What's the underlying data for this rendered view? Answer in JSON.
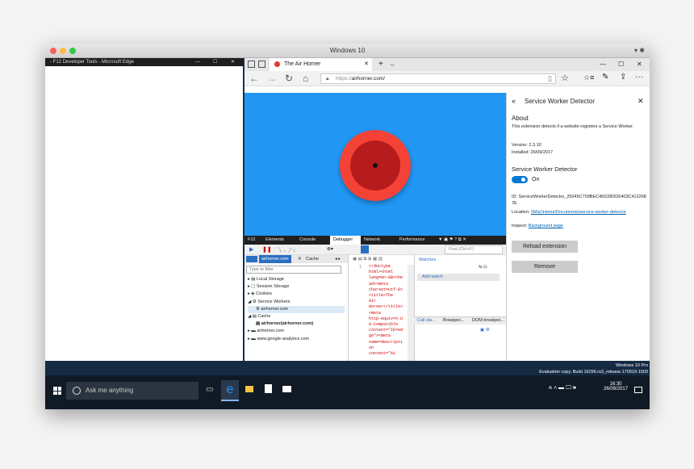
{
  "window": {
    "title": "Windows 10",
    "controls": "▾ ✱"
  },
  "f12": {
    "title": "- F12 Developer Tools - Microsoft Edge",
    "min": "—",
    "max": "☐",
    "close": "✕"
  },
  "edge": {
    "tab_title": "The Air Horner",
    "tab_close": "✕",
    "new_tab": "+",
    "tab_menu": "⌵",
    "url_prefix": "https://",
    "url_domain": "airhorner.com/",
    "win_min": "—",
    "win_max": "☐",
    "win_close": "✕",
    "nav": {
      "back": "←",
      "forward": "→",
      "refresh": "↻",
      "home": "⌂",
      "reading": "▯",
      "fav": "☆",
      "hub": "☆≡",
      "note": "✎",
      "share": "⇪",
      "more": "···"
    }
  },
  "extension": {
    "header": "Service Worker Detector",
    "back": "«",
    "close": "✕",
    "about_heading": "About",
    "about_text": "This extension detects if a website registers a Service Worker.",
    "version": "Version: 2.3.10",
    "installed": "Installed: 26/09/2017",
    "detector_heading": "Service Worker Detector",
    "toggle_label": "On",
    "id_text": "ID: ServiceWorkerDetector_25045C703BEC45D28DD6403C4122687E",
    "location_label": "Location:",
    "location_link": "\\\\Mac\\Home\\Documents\\service-worker-detector",
    "inspect_label": "Inspect:",
    "inspect_link": "Background page",
    "reload_button": "Reload extension",
    "remove_button": "Remove"
  },
  "devtools": {
    "tabs": [
      "F12",
      "Elements",
      "Console",
      "Debugger",
      "Network",
      "Performance"
    ],
    "search_placeholder": "Find (Ctrl+F)",
    "file_tab1": "airhorner.com",
    "file_tab2": "Cache",
    "filter_placeholder": "Type to filter",
    "tree": [
      "Local Storage",
      "Session Storage",
      "Cookies",
      "Service Workers",
      "airhorner.com",
      "Cache",
      "airhorner(airhorner.com)",
      "airhorner.com",
      "www.google-analytics.com"
    ],
    "code_line": "1",
    "code": [
      "<!doctype",
      "html><html",
      "lang=en-GB><he",
      "ad><meta",
      "charset=utf-8>",
      "<title>The",
      "Air",
      "Horner</title>",
      "<meta",
      "http-equiv=X-U",
      "A-Compatible",
      "content=\"IE=ed",
      "ge\"><meta",
      "name=descripti",
      "on",
      "content=\"Ai"
    ],
    "watches": "Watches",
    "add_watch": "Add watch",
    "bottom_tabs": [
      "Call sta...",
      "Breakpoi...",
      "DOM breakpoi..."
    ]
  },
  "taskbar": {
    "search": "Ask me anything",
    "watermark1": "Windows 10 Pro",
    "watermark2": "Evaluation copy. Build 16296.rs3_release.170919-1503",
    "time": "16:30",
    "date": "26/09/2017",
    "tray": "ጰ ∧ ▬ 🖵 🕪"
  },
  "colors": {
    "page_bg": "#2196f3",
    "horn_outer": "#f44336",
    "horn_inner": "#b71c1c",
    "toggle": "#0078d7"
  }
}
